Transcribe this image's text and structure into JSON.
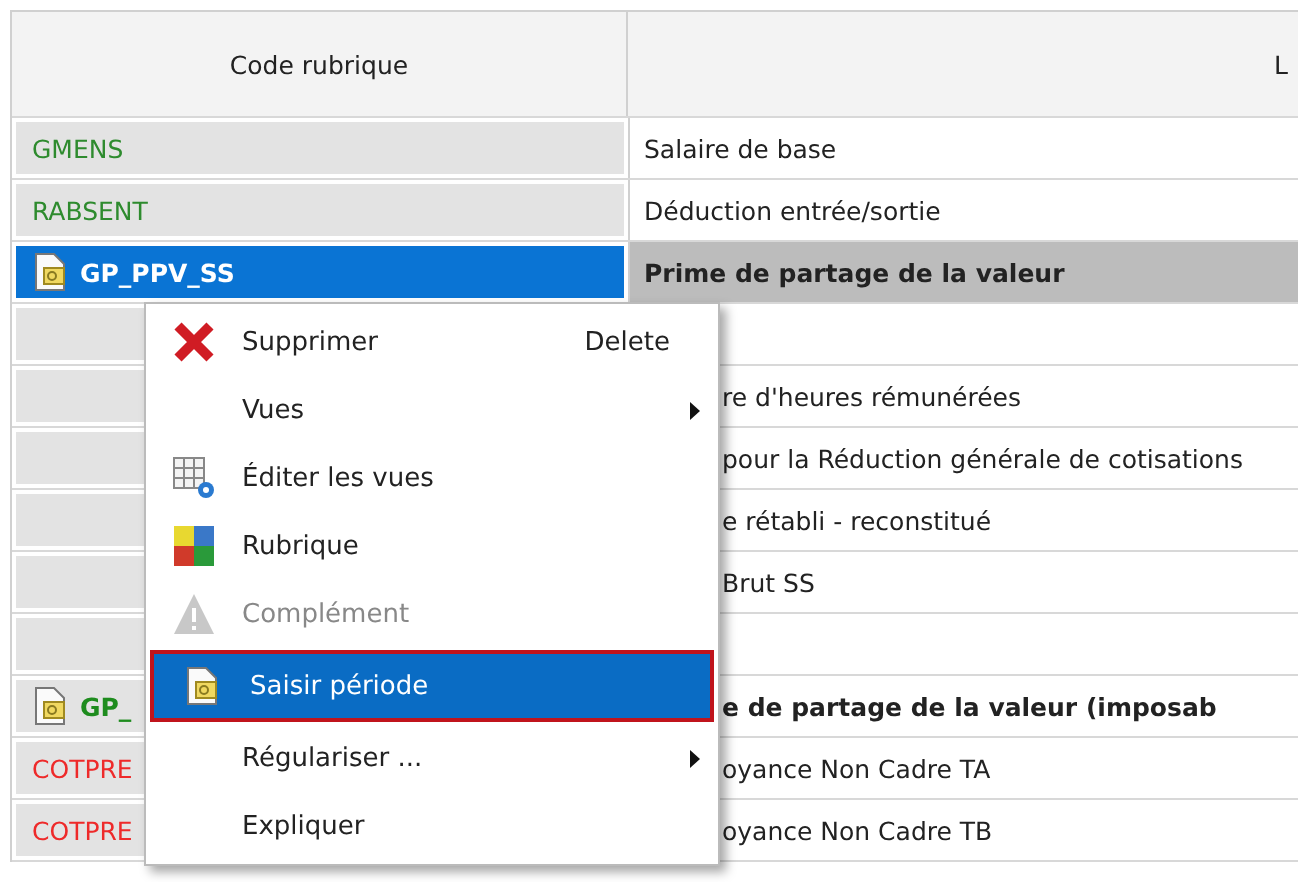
{
  "table": {
    "columns": [
      "Code rubrique",
      "L"
    ],
    "rows": [
      {
        "code": "GMENS",
        "label": "Salaire de base",
        "color": "#2e8b2e",
        "kind": "item",
        "selected": false
      },
      {
        "code": "RABSENT",
        "label": "Déduction entrée/sortie",
        "color": "#2e8b2e",
        "kind": "item",
        "selected": false
      },
      {
        "code": "GP_PPV_SS",
        "label": "Prime de partage de la valeur",
        "kind": "group",
        "selected": true
      },
      {
        "kind": "item",
        "selected": false
      },
      {
        "label": "re d'heures rémunérées",
        "kind": "item",
        "selected": false
      },
      {
        "label": "pour la Réduction générale de cotisations",
        "kind": "item",
        "selected": false
      },
      {
        "label": "e rétabli - reconstitué",
        "kind": "item",
        "selected": false
      },
      {
        "label": "Brut SS",
        "kind": "item",
        "selected": false
      },
      {
        "kind": "item",
        "selected": false
      },
      {
        "code": "GP_",
        "label": "e de partage de la valeur (imposab",
        "color": "#1e8c1e",
        "kind": "group",
        "selected": false
      },
      {
        "code": "COTPRE",
        "label": "oyance Non Cadre TA",
        "color": "#ee2a2a",
        "kind": "item",
        "selected": false
      },
      {
        "code": "COTPRE",
        "label": "oyance Non Cadre TB",
        "color": "#ee2a2a",
        "kind": "item",
        "selected": false
      }
    ]
  },
  "context_menu": {
    "items": [
      {
        "label": "Supprimer",
        "shortcut": "Delete",
        "kind": "delete",
        "submenu": false,
        "disabled": false,
        "selected": false
      },
      {
        "label": "Vues",
        "submenu": true,
        "disabled": false,
        "selected": false
      },
      {
        "label": "Éditer les vues",
        "kind": "grid",
        "submenu": false,
        "disabled": false,
        "selected": false
      },
      {
        "label": "Rubrique",
        "kind": "blocks",
        "submenu": false,
        "disabled": false,
        "selected": false
      },
      {
        "label": "Complément",
        "kind": "warning",
        "submenu": false,
        "disabled": true,
        "selected": false
      },
      {
        "label": "Saisir période",
        "kind": "document",
        "submenu": false,
        "disabled": false,
        "selected": true
      },
      {
        "label": "Régulariser ...",
        "submenu": true,
        "disabled": false,
        "selected": false
      },
      {
        "label": "Expliquer",
        "submenu": false,
        "disabled": false,
        "selected": false
      }
    ]
  }
}
